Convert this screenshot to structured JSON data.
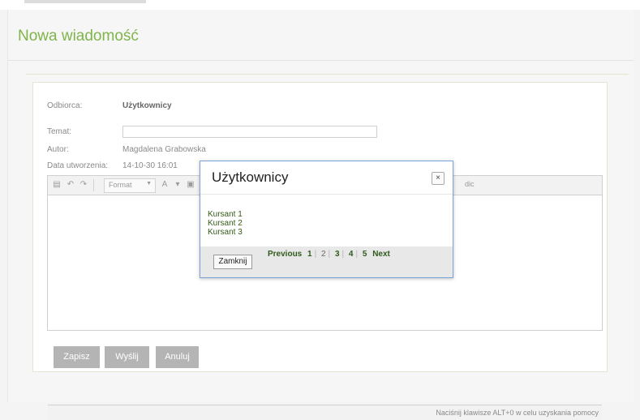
{
  "page": {
    "title": "Nowa wiadomość"
  },
  "form": {
    "recipient_label": "Odbiorca:",
    "recipient_value": "Użytkownicy",
    "subject_label": "Temat:",
    "subject_value": "",
    "author_label": "Autor:",
    "author_value": "Magdalena Grabowska",
    "created_label": "Data utworzenia:",
    "created_value": "14-10-30 16:01"
  },
  "editor": {
    "format_label": "Format",
    "toolbar_right_label": "dic",
    "help_text": "Naciśnij klawisze ALT+0 w celu uzyskania pomocy"
  },
  "actions": {
    "save": "Zapisz",
    "send": "Wyślij",
    "cancel": "Anuluj"
  },
  "modal": {
    "title": "Użytkownicy",
    "close_icon": "×",
    "users": [
      "Kursant 1",
      "Kursant 2",
      "Kursant 3"
    ],
    "close_button": "Zamknij",
    "pager": {
      "previous": "Previous",
      "pages": [
        "1",
        "2",
        "3",
        "4",
        "5"
      ],
      "next": "Next"
    }
  }
}
